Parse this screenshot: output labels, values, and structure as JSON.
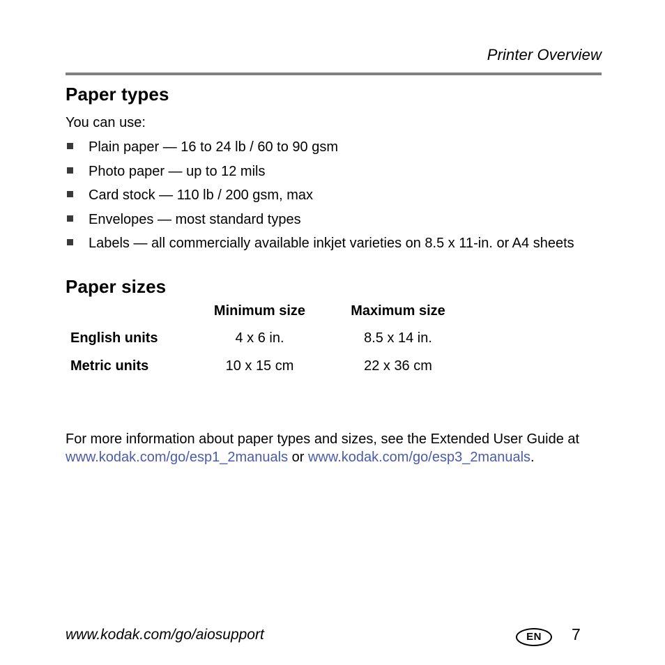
{
  "running_head": "Printer Overview",
  "sections": {
    "paper_types": {
      "heading": "Paper types",
      "intro": "You can use:",
      "bullets": [
        "Plain paper — 16 to 24 lb / 60 to 90 gsm",
        "Photo paper — up to 12 mils",
        "Card stock — 110 lb / 200 gsm, max",
        "Envelopes — most standard types",
        "Labels — all commercially available inkjet varieties on 8.5 x 11-in. or A4 sheets"
      ]
    },
    "paper_sizes": {
      "heading": "Paper sizes",
      "table": {
        "headers": [
          "",
          "Minimum size",
          "Maximum size"
        ],
        "rows": [
          {
            "label": "English units",
            "minimum": "4 x 6 in.",
            "maximum": "8.5 x 14 in."
          },
          {
            "label": "Metric units",
            "minimum": "10 x 15 cm",
            "maximum": "22 x 36 cm"
          }
        ]
      }
    }
  },
  "more_info": {
    "lead": "For more information about paper types and sizes, see the Extended User Guide at ",
    "link1": "www.kodak.com/go/esp1_2manuals",
    "separator": " or ",
    "link2": "www.kodak.com/go/esp3_2manuals",
    "trailing": "."
  },
  "footer": {
    "url": "www.kodak.com/go/aiosupport",
    "language_badge": "EN",
    "page_number": "7"
  },
  "colors": {
    "link": "#4a5bab",
    "rule": "#808080",
    "bullet": "#3a3a3a",
    "text": "#000000",
    "background": "#ffffff"
  }
}
